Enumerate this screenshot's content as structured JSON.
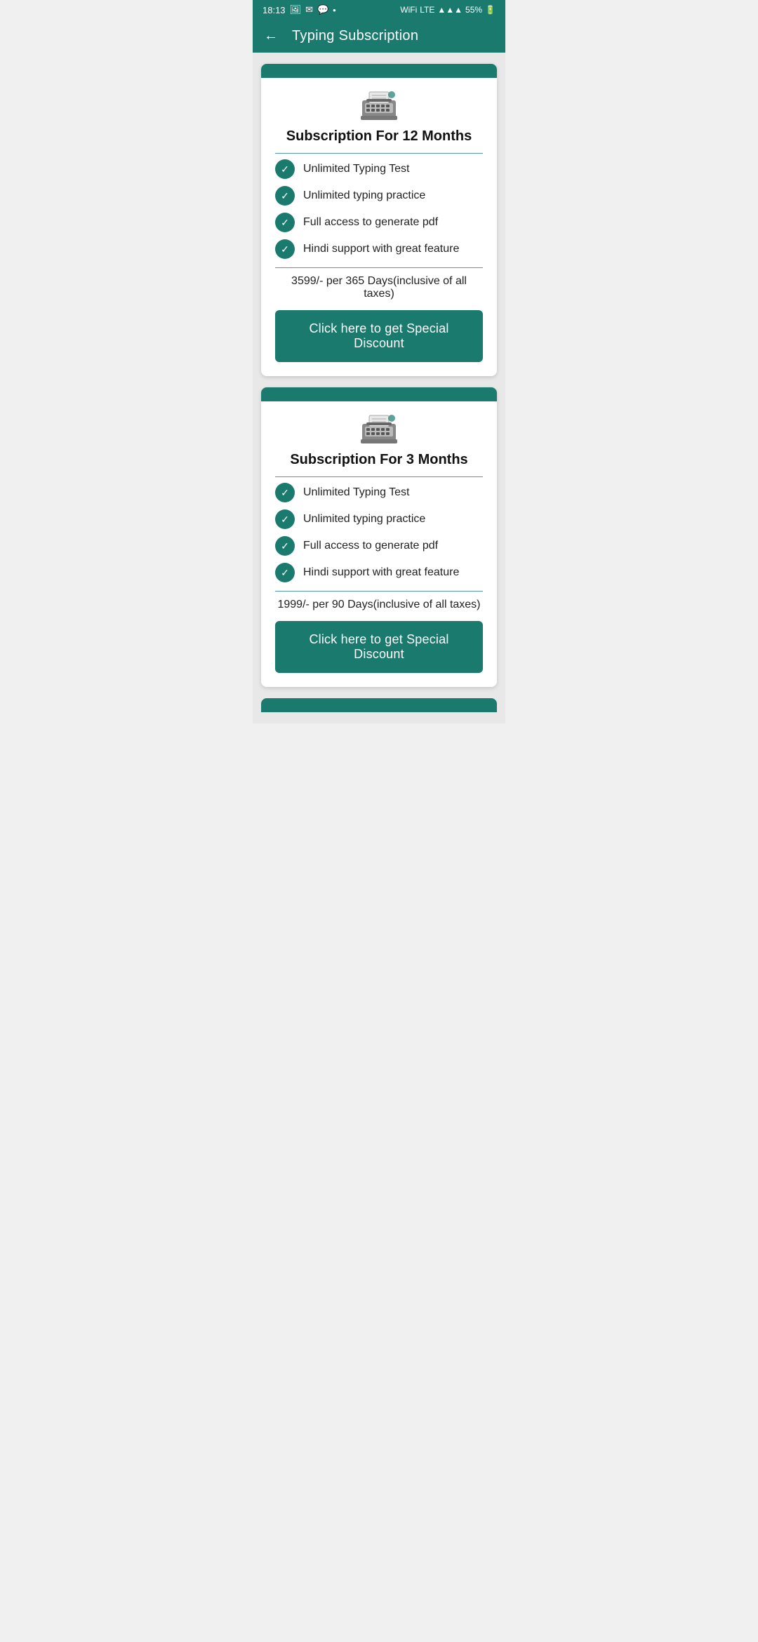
{
  "statusBar": {
    "time": "18:13",
    "battery": "55%",
    "icons": [
      "photo-icon",
      "mail-icon",
      "message-icon",
      "dot-icon",
      "wifi-icon",
      "lte-icon",
      "signal-icon",
      "battery-icon"
    ]
  },
  "header": {
    "backLabel": "←",
    "title": "Typing Subscription"
  },
  "cards": [
    {
      "id": "card-12months",
      "title": "Subscription For 12 Months",
      "features": [
        "Unlimited Typing Test",
        "Unlimited typing practice",
        "Full access to generate pdf",
        "Hindi support with great feature"
      ],
      "price": "3599/- per 365 Days(inclusive of all taxes)",
      "buttonLabel": "Click here to get Special Discount"
    },
    {
      "id": "card-3months",
      "title": "Subscription For 3 Months",
      "features": [
        "Unlimited Typing Test",
        "Unlimited typing practice",
        "Full access to generate pdf",
        "Hindi support with great feature"
      ],
      "price": "1999/- per 90 Days(inclusive of all taxes)",
      "buttonLabel": "Click here to get Special Discount"
    }
  ],
  "colors": {
    "teal": "#1a7a6e",
    "divider": "#5599aa",
    "white": "#ffffff",
    "text": "#222222"
  }
}
